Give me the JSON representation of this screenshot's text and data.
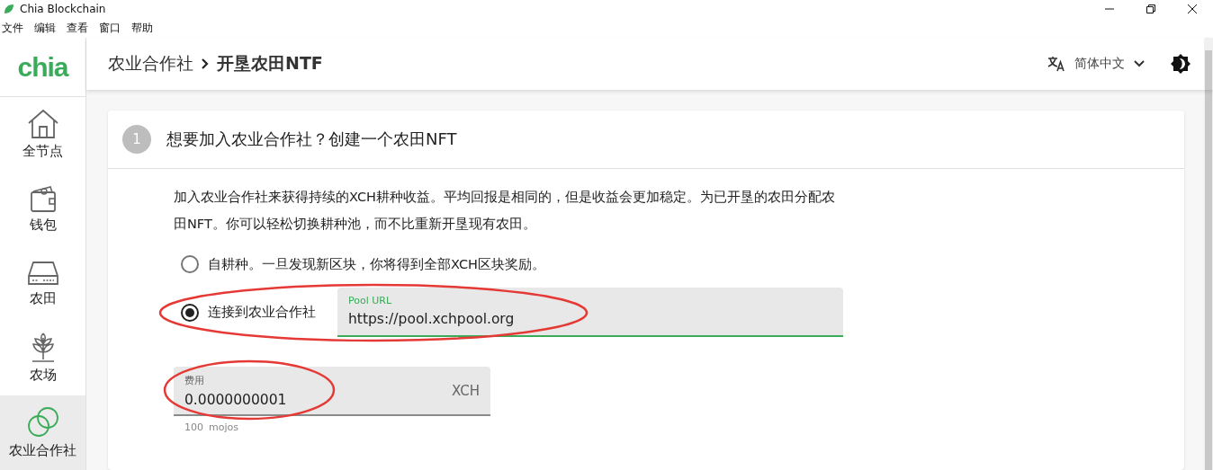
{
  "window": {
    "title": "Chia Blockchain"
  },
  "menu": [
    "文件",
    "编辑",
    "查看",
    "窗口",
    "帮助"
  ],
  "header": {
    "logo": "chia",
    "breadcrumb": [
      {
        "label": "农业合作社"
      },
      {
        "label": "开垦农田NTF"
      }
    ],
    "language": "简体中文"
  },
  "sidebar": {
    "items": [
      {
        "label": "全节点",
        "selected": false
      },
      {
        "label": "钱包",
        "selected": false
      },
      {
        "label": "农田",
        "selected": false
      },
      {
        "label": "农场",
        "selected": false
      },
      {
        "label": "农业合作社",
        "selected": true
      }
    ]
  },
  "step": {
    "number": "1",
    "title": "想要加入农业合作社？创建一个农田NFT",
    "description": "加入农业合作社来获得持续的XCH耕种收益。平均回报是相同的，但是收益会更加稳定。为已开垦的农田分配农田NFT。你可以轻松切换耕种池，而不比重新开垦现有农田。",
    "options": [
      {
        "label": "自耕种。一旦发现新区块，你将得到全部XCH区块奖励。",
        "selected": false,
        "circled": false
      },
      {
        "label": "连接到农业合作社",
        "selected": true,
        "circled": true,
        "field": {
          "label": "Pool URL",
          "value": "https://pool.xchpool.org",
          "focused": true
        }
      }
    ],
    "fee": {
      "label": "费用",
      "value": "0.0000000001",
      "unit": "XCH",
      "helper": [
        "100",
        "mojos"
      ],
      "circled": true
    }
  }
}
